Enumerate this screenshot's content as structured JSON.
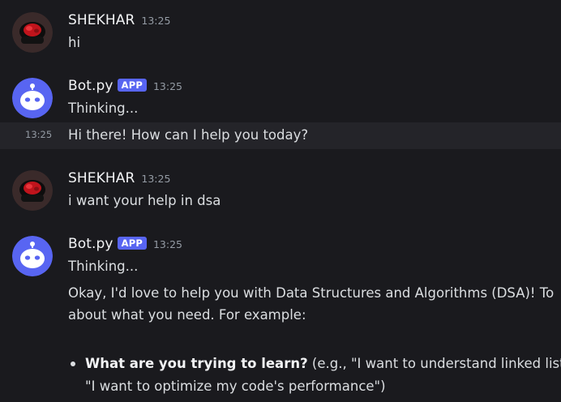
{
  "messages": [
    {
      "username": "SHEKHAR",
      "timestamp": "13:25",
      "lines": [
        "hi"
      ]
    },
    {
      "username": "Bot.py",
      "badge": "APP",
      "timestamp": "13:25",
      "lines": [
        "Thinking..."
      ],
      "followup": {
        "side_timestamp": "13:25",
        "text": "Hi there! How can I help you today?"
      }
    },
    {
      "username": "SHEKHAR",
      "timestamp": "13:25",
      "lines": [
        "i want your help in dsa"
      ]
    },
    {
      "username": "Bot.py",
      "badge": "APP",
      "timestamp": "13:25",
      "lines": [
        "Thinking...",
        "Okay, I'd love to help you with Data Structures and Algorithms (DSA)! To",
        "about what you need. For example:"
      ],
      "bullet": {
        "bold": "What are you trying to learn?",
        "rest_line1": " (e.g., \"I want to understand linked lists\"",
        "line2": "\"I want to optimize my code's performance\")"
      }
    }
  ],
  "colors": {
    "background": "#1a1a1e",
    "hover_row": "#242429",
    "badge": "#5865f2",
    "bot_avatar": "#5865f2",
    "text": "#dbdee1",
    "timestamp": "#949ba4"
  },
  "icons": {
    "user_avatar": "red-black-avatar-icon",
    "bot_avatar": "discord-bot-face-icon"
  }
}
